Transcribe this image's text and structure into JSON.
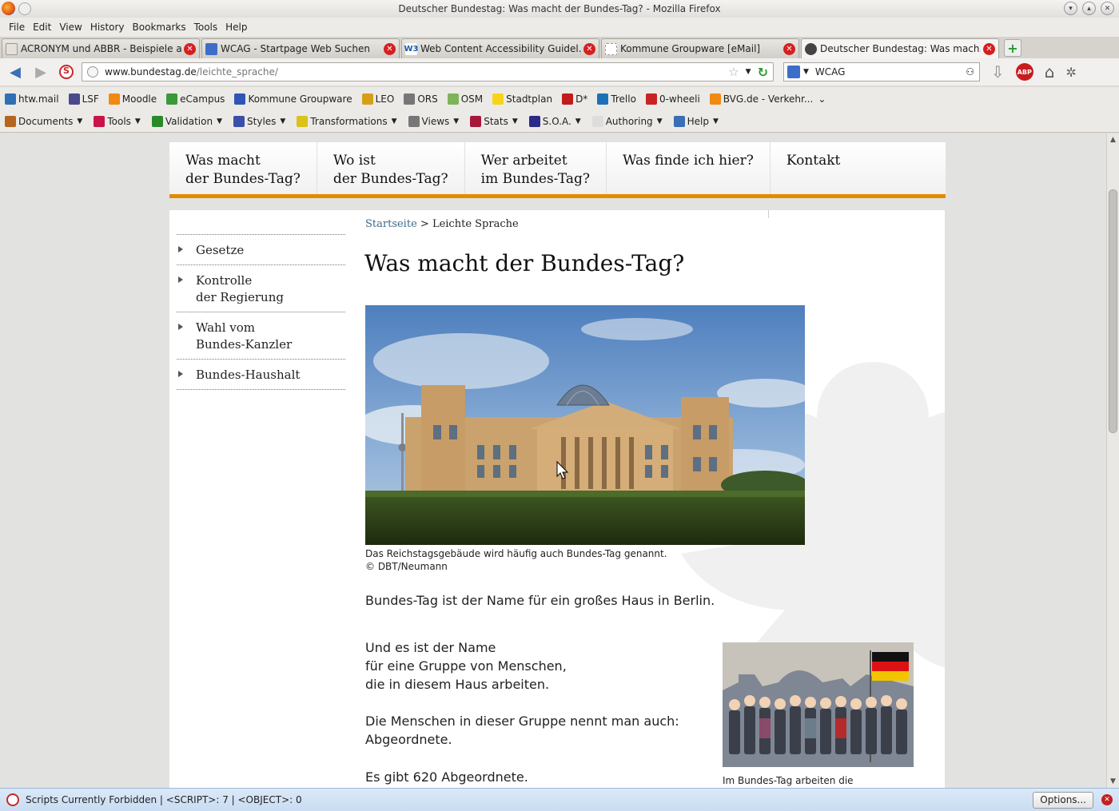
{
  "window": {
    "title": "Deutscher Bundestag: Was macht der Bundes-Tag? - Mozilla Firefox"
  },
  "menu": [
    "File",
    "Edit",
    "View",
    "History",
    "Bookmarks",
    "Tools",
    "Help"
  ],
  "tabs": [
    {
      "label": "ACRONYM und ABBR - Beispiele a...",
      "icon": "doc-icon",
      "color": "#e6e1d7"
    },
    {
      "label": "WCAG - Startpage Web Suchen",
      "icon": "startpage-icon",
      "color": "#3d6dc9"
    },
    {
      "label": "Web Content Accessibility Guidel...",
      "icon": "w3c-icon",
      "color": "#1b5aa6"
    },
    {
      "label": "Kommune Groupware [eMail]",
      "icon": "blank-page-icon",
      "color": "#ffffff"
    },
    {
      "label": "Deutscher Bundestag: Was mach...",
      "icon": "bundestag-eagle-icon",
      "color": "#444444"
    }
  ],
  "navbar": {
    "url_host": "www.bundestag.de",
    "url_path": "/leichte_sprache/",
    "search_value": "WCAG"
  },
  "bookmarks": [
    {
      "label": "htw.mail",
      "color": "#2f6fb5"
    },
    {
      "label": "LSF",
      "color": "#4a4a8a"
    },
    {
      "label": "Moodle",
      "color": "#f08a12"
    },
    {
      "label": "eCampus",
      "color": "#3a9a3a"
    },
    {
      "label": "Kommune Groupware",
      "color": "#2f55b5"
    },
    {
      "label": "LEO",
      "color": "#d4a017"
    },
    {
      "label": "ORS",
      "color": "#777777"
    },
    {
      "label": "OSM",
      "color": "#7eb35a"
    },
    {
      "label": "Stadtplan",
      "color": "#f7d417"
    },
    {
      "label": "D*",
      "color": "#c21b1b"
    },
    {
      "label": "Trello",
      "color": "#1d6fb8"
    },
    {
      "label": "0-wheeli",
      "color": "#c82323"
    },
    {
      "label": "BVG.de - Verkehr...",
      "color": "#f08a12"
    }
  ],
  "devtools": [
    {
      "label": "Documents",
      "color": "#b5651d"
    },
    {
      "label": "Tools",
      "color": "#c8144a"
    },
    {
      "label": "Validation",
      "color": "#2a8a2a"
    },
    {
      "label": "Styles",
      "color": "#3b4fa8"
    },
    {
      "label": "Transformations",
      "color": "#d9c21a"
    },
    {
      "label": "Views",
      "color": "#777777"
    },
    {
      "label": "Stats",
      "color": "#a8173a"
    },
    {
      "label": "S.O.A.",
      "color": "#2a2a8a"
    },
    {
      "label": "Authoring",
      "color": "#dddddd"
    },
    {
      "label": "Help",
      "color": "#3a6fb5"
    }
  ],
  "site": {
    "nav": [
      "Was macht\nder Bundes-Tag?",
      "Wo ist\nder Bundes-Tag?",
      "Wer arbeitet\nim Bundes-Tag?",
      "Was finde ich hier?",
      "Kontakt"
    ],
    "sidebar": [
      "Gesetze",
      "Kontrolle\nder Regierung",
      "Wahl vom\nBundes-Kanzler",
      "Bundes-Haushalt"
    ],
    "breadcrumb_link": "Startseite",
    "breadcrumb_sep": ">",
    "breadcrumb_current": "Leichte Sprache",
    "page_title": "Was macht der Bundes-Tag?",
    "image_caption_1": "Das Reichstagsgebäude wird häufig auch Bundes-Tag genannt.",
    "image_caption_2": "© DBT/Neumann",
    "para1": "Bundes-Tag ist der Name für ein großes Haus in Berlin.",
    "para2": "Und es ist der Name\nfür eine Gruppe von Menschen,\ndie in diesem Haus arbeiten.",
    "para3": "Die Menschen in dieser Gruppe nennt man auch:\nAbgeordnete.",
    "para4": "Es gibt 620 Abgeordnete.",
    "side_image_caption": "Im Bundes-Tag arbeiten die",
    "accent_color": "#e58a00"
  },
  "statusbar": {
    "text": "Scripts Currently Forbidden | <SCRIPT>: 7 | <OBJECT>: 0",
    "options_label": "Options..."
  }
}
